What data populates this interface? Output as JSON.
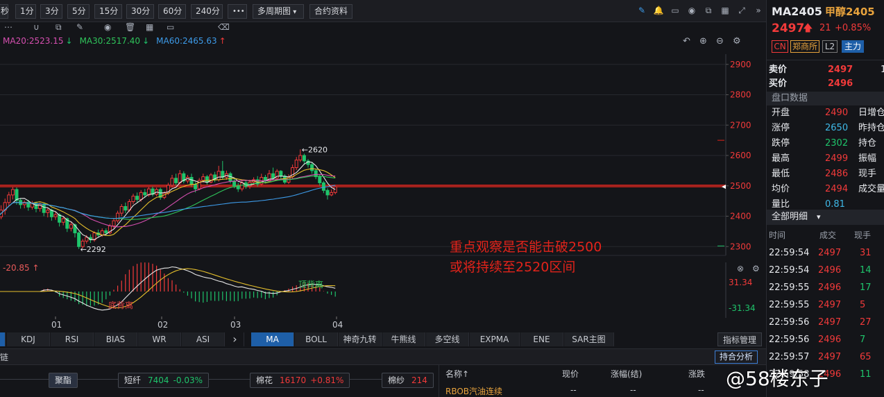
{
  "toolbar": {
    "periods": [
      "秒",
      "1分",
      "3分",
      "5分",
      "15分",
      "30分",
      "60分",
      "240分"
    ],
    "more": "•••",
    "multi_period": "多周期图",
    "contract_info": "合约资料",
    "right_icons": [
      "pencil-icon",
      "bell-icon",
      "clipboard-icon",
      "camera-icon",
      "window-icon",
      "grid-icon",
      "expand-icon",
      "chevrons-right-icon"
    ]
  },
  "drawbar": {
    "icons": [
      "more-icon",
      "magnet-icon",
      "copy-icon",
      "pen-icon",
      "eye-icon",
      "trash-icon",
      "layout-icon",
      "comment-icon",
      "erase-icon"
    ]
  },
  "ma": [
    {
      "label": "MA20:2523.15",
      "arrow": "↓",
      "color": "#d64fb0",
      "arrow_color": "#1fc46b"
    },
    {
      "label": "MA30:2517.40",
      "arrow": "↓",
      "color": "#2fc45a",
      "arrow_color": "#1fc46b"
    },
    {
      "label": "MA60:2465.63",
      "arrow": "↑",
      "color": "#3d9be9",
      "arrow_color": "#f23a3a"
    }
  ],
  "annotation": {
    "line1": "重点观察是否能击破2500",
    "line2": "或将持续至2520区间"
  },
  "sub_indicator": {
    "value": "-20.85",
    "arrow": "↑"
  },
  "chart_data": {
    "type": "candlestick",
    "y_ticks": [
      2900,
      2800,
      2700,
      2600,
      2500,
      2400,
      2300
    ],
    "ylim": [
      2280,
      2920
    ],
    "x_ticks": [
      "01",
      "02",
      "03",
      "04"
    ],
    "high_label": "2620",
    "low_label": "2292",
    "current_price": 2497,
    "candles": [
      [
        2355,
        2398,
        2340,
        2412
      ],
      [
        2398,
        2420,
        2390,
        2436
      ],
      [
        2420,
        2445,
        2405,
        2458
      ],
      [
        2445,
        2470,
        2432,
        2480
      ],
      [
        2470,
        2488,
        2455,
        2496
      ],
      [
        2488,
        2452,
        2438,
        2495
      ],
      [
        2452,
        2438,
        2425,
        2460
      ],
      [
        2438,
        2446,
        2426,
        2452
      ],
      [
        2446,
        2430,
        2418,
        2454
      ],
      [
        2430,
        2442,
        2422,
        2450
      ],
      [
        2442,
        2425,
        2413,
        2448
      ],
      [
        2425,
        2440,
        2415,
        2445
      ],
      [
        2440,
        2412,
        2400,
        2444
      ],
      [
        2412,
        2420,
        2396,
        2428
      ],
      [
        2420,
        2398,
        2385,
        2425
      ],
      [
        2398,
        2405,
        2388,
        2414
      ],
      [
        2405,
        2380,
        2366,
        2410
      ],
      [
        2380,
        2392,
        2370,
        2398
      ],
      [
        2392,
        2360,
        2348,
        2396
      ],
      [
        2360,
        2372,
        2350,
        2380
      ],
      [
        2372,
        2345,
        2330,
        2376
      ],
      [
        2345,
        2300,
        2292,
        2350
      ],
      [
        2300,
        2318,
        2294,
        2325
      ],
      [
        2318,
        2330,
        2310,
        2338
      ],
      [
        2330,
        2322,
        2312,
        2340
      ],
      [
        2322,
        2345,
        2316,
        2350
      ],
      [
        2345,
        2338,
        2330,
        2356
      ],
      [
        2338,
        2352,
        2332,
        2360
      ],
      [
        2352,
        2345,
        2335,
        2360
      ],
      [
        2345,
        2368,
        2340,
        2375
      ],
      [
        2368,
        2385,
        2360,
        2392
      ],
      [
        2385,
        2410,
        2378,
        2418
      ],
      [
        2410,
        2432,
        2400,
        2440
      ],
      [
        2432,
        2420,
        2410,
        2445
      ],
      [
        2420,
        2448,
        2414,
        2456
      ],
      [
        2448,
        2466,
        2440,
        2474
      ],
      [
        2466,
        2455,
        2445,
        2478
      ],
      [
        2455,
        2478,
        2448,
        2486
      ],
      [
        2478,
        2470,
        2460,
        2490
      ],
      [
        2470,
        2490,
        2464,
        2496
      ],
      [
        2490,
        2472,
        2465,
        2498
      ],
      [
        2472,
        2488,
        2466,
        2494
      ],
      [
        2488,
        2462,
        2454,
        2494
      ],
      [
        2462,
        2476,
        2456,
        2482
      ],
      [
        2476,
        2502,
        2470,
        2510
      ],
      [
        2502,
        2525,
        2494,
        2536
      ],
      [
        2525,
        2510,
        2502,
        2540
      ],
      [
        2510,
        2540,
        2505,
        2552
      ],
      [
        2540,
        2516,
        2508,
        2548
      ],
      [
        2516,
        2528,
        2508,
        2536
      ],
      [
        2528,
        2505,
        2498,
        2540
      ],
      [
        2505,
        2490,
        2478,
        2512
      ],
      [
        2490,
        2518,
        2486,
        2526
      ],
      [
        2518,
        2530,
        2510,
        2540
      ],
      [
        2530,
        2512,
        2504,
        2536
      ],
      [
        2512,
        2536,
        2508,
        2542
      ],
      [
        2536,
        2520,
        2512,
        2546
      ],
      [
        2520,
        2548,
        2514,
        2566
      ],
      [
        2548,
        2528,
        2520,
        2582
      ],
      [
        2528,
        2540,
        2520,
        2550
      ],
      [
        2540,
        2516,
        2508,
        2546
      ],
      [
        2516,
        2500,
        2492,
        2524
      ],
      [
        2500,
        2490,
        2480,
        2510
      ],
      [
        2490,
        2510,
        2482,
        2520
      ],
      [
        2510,
        2498,
        2490,
        2518
      ],
      [
        2498,
        2512,
        2490,
        2520
      ],
      [
        2512,
        2520,
        2504,
        2528
      ],
      [
        2520,
        2506,
        2498,
        2532
      ],
      [
        2506,
        2528,
        2500,
        2540
      ],
      [
        2528,
        2516,
        2508,
        2536
      ],
      [
        2516,
        2540,
        2512,
        2552
      ],
      [
        2540,
        2525,
        2518,
        2560
      ],
      [
        2525,
        2548,
        2520,
        2555
      ],
      [
        2548,
        2532,
        2524,
        2552
      ],
      [
        2532,
        2512,
        2506,
        2538
      ],
      [
        2512,
        2530,
        2506,
        2538
      ],
      [
        2530,
        2560,
        2524,
        2570
      ],
      [
        2560,
        2585,
        2552,
        2595
      ],
      [
        2585,
        2600,
        2578,
        2620
      ],
      [
        2600,
        2582,
        2570,
        2606
      ],
      [
        2582,
        2570,
        2560,
        2588
      ],
      [
        2570,
        2550,
        2540,
        2576
      ],
      [
        2550,
        2530,
        2522,
        2556
      ],
      [
        2530,
        2510,
        2500,
        2538
      ],
      [
        2510,
        2485,
        2476,
        2516
      ],
      [
        2485,
        2470,
        2455,
        2492
      ],
      [
        2470,
        2478,
        2466,
        2488
      ],
      [
        2478,
        2497,
        2472,
        2500
      ]
    ],
    "ma_lines": [
      {
        "name": "MA5",
        "color": "#e8e8e8"
      },
      {
        "name": "MA10",
        "color": "#e6c02c"
      },
      {
        "name": "MA20",
        "color": "#d64fb0"
      },
      {
        "name": "MA30",
        "color": "#2fc45a"
      },
      {
        "name": "MA60",
        "color": "#3d9be9"
      }
    ],
    "sub_axis": {
      "top": "31.34",
      "bottom": "-31.34"
    },
    "sub_labels": [
      {
        "text": "底背离",
        "color": "#e24040"
      },
      {
        "text": "顶背离",
        "color": "#2fc45a"
      }
    ]
  },
  "indicator_tabs_left": [
    "KDJ",
    "RSI",
    "BIAS",
    "WR",
    "ASI"
  ],
  "indicator_tabs_right": [
    "MA",
    "BOLL",
    "神奇九转",
    "牛熊线",
    "多空线",
    "EXPMA",
    "ENE",
    "SAR主图"
  ],
  "indicator_manage": "指标管理",
  "bottom_bar": {
    "left": "链",
    "right_button": "持合分析"
  },
  "chain": [
    {
      "name": "聚酯"
    },
    {
      "name": "短纤",
      "price": "7404",
      "change": "-0.03%",
      "change_color": "#1fc46b"
    },
    {
      "name": "棉花",
      "price": "16170",
      "change": "+0.81%",
      "change_color": "#f23a3a"
    },
    {
      "name": "棉纱",
      "price": "214",
      "change": "",
      "change_color": "#f23a3a"
    }
  ],
  "list_header": [
    "名称↑",
    "现价",
    "涨幅(结)",
    "涨跌"
  ],
  "list_rows": [
    {
      "name": "RBOB汽油连续",
      "price": "--",
      "pct": "--",
      "chg": "--"
    }
  ],
  "quote": {
    "code": "MA2405",
    "name": "甲醇2405",
    "price": "2497",
    "arrow": "🡅",
    "change": "21",
    "pct": "+0.85%",
    "tags": [
      "CN",
      "郑商所",
      "L2",
      "主力"
    ],
    "ask_label": "卖价",
    "ask": "2497",
    "ask_vol": "1",
    "bid_label": "买价",
    "bid": "2496",
    "section": "盘口数据",
    "stats": [
      {
        "label": "开盘",
        "value": "2490",
        "color": "#f23a3a",
        "extra": "日增仓"
      },
      {
        "label": "涨停",
        "value": "2650",
        "color": "#3fb9e8",
        "extra": "昨持仓"
      },
      {
        "label": "跌停",
        "value": "2302",
        "color": "#1fc46b",
        "extra": "持仓"
      },
      {
        "label": "最高",
        "value": "2499",
        "color": "#f23a3a",
        "extra": "振幅"
      },
      {
        "label": "最低",
        "value": "2486",
        "color": "#f23a3a",
        "extra": "现手"
      },
      {
        "label": "均价",
        "value": "2494",
        "color": "#f23a3a",
        "extra": "成交量"
      },
      {
        "label": "量比",
        "value": "0.81",
        "color": "#3fb9e8",
        "extra": ""
      }
    ],
    "trades_title": "全部明细",
    "trades_header": [
      "时间",
      "成交",
      "现手"
    ],
    "trades": [
      {
        "time": "22:59:54",
        "price": "2497",
        "vol": "31",
        "color": "#f23a3a"
      },
      {
        "time": "22:59:54",
        "price": "2496",
        "vol": "14",
        "color": "#1fc46b"
      },
      {
        "time": "22:59:55",
        "price": "2496",
        "vol": "17",
        "color": "#1fc46b"
      },
      {
        "time": "22:59:55",
        "price": "2497",
        "vol": "5",
        "color": "#f23a3a"
      },
      {
        "time": "22:59:56",
        "price": "2497",
        "vol": "27",
        "color": "#f23a3a"
      },
      {
        "time": "22:59:56",
        "price": "2496",
        "vol": "7",
        "color": "#1fc46b"
      },
      {
        "time": "22:59:57",
        "price": "2497",
        "vol": "65",
        "color": "#f23a3a"
      },
      {
        "time": "22:59:58",
        "price": "2496",
        "vol": "11",
        "color": "#1fc46b"
      }
    ]
  },
  "watermark": "@58楼东子"
}
